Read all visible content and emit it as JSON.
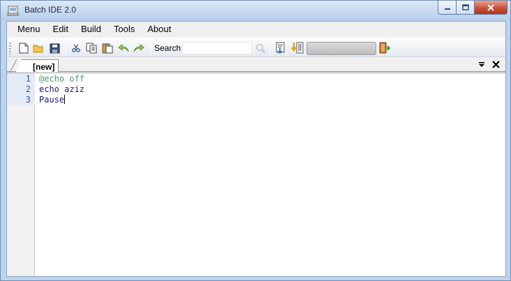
{
  "window": {
    "title": "Batch IDE 2.0"
  },
  "menu": {
    "items": [
      "Menu",
      "Edit",
      "Build",
      "Tools",
      "About"
    ]
  },
  "toolbar": {
    "search_label": "Search",
    "search_value": "",
    "progress_fraction": 0.0,
    "icons": [
      "new-file-icon",
      "open-folder-icon",
      "save-icon",
      "cut-icon",
      "copy-icon",
      "paste-icon",
      "undo-icon",
      "redo-icon",
      "find-icon",
      "compile-icon",
      "run-icon",
      "exit-icon"
    ]
  },
  "tabs": [
    {
      "label": "[new]",
      "active": true
    }
  ],
  "editor": {
    "lines": [
      {
        "number": "1",
        "text": "@echo off",
        "color": "#4a9a6e"
      },
      {
        "number": "2",
        "text": "echo aziz",
        "color": "#1a1a8c"
      },
      {
        "number": "3",
        "text": "Pause",
        "color": "#1a1a8c"
      }
    ]
  },
  "colors": {
    "titlebar": "#c4d8f0",
    "close_button": "#c9543b",
    "line_number": "#2b58a8"
  }
}
